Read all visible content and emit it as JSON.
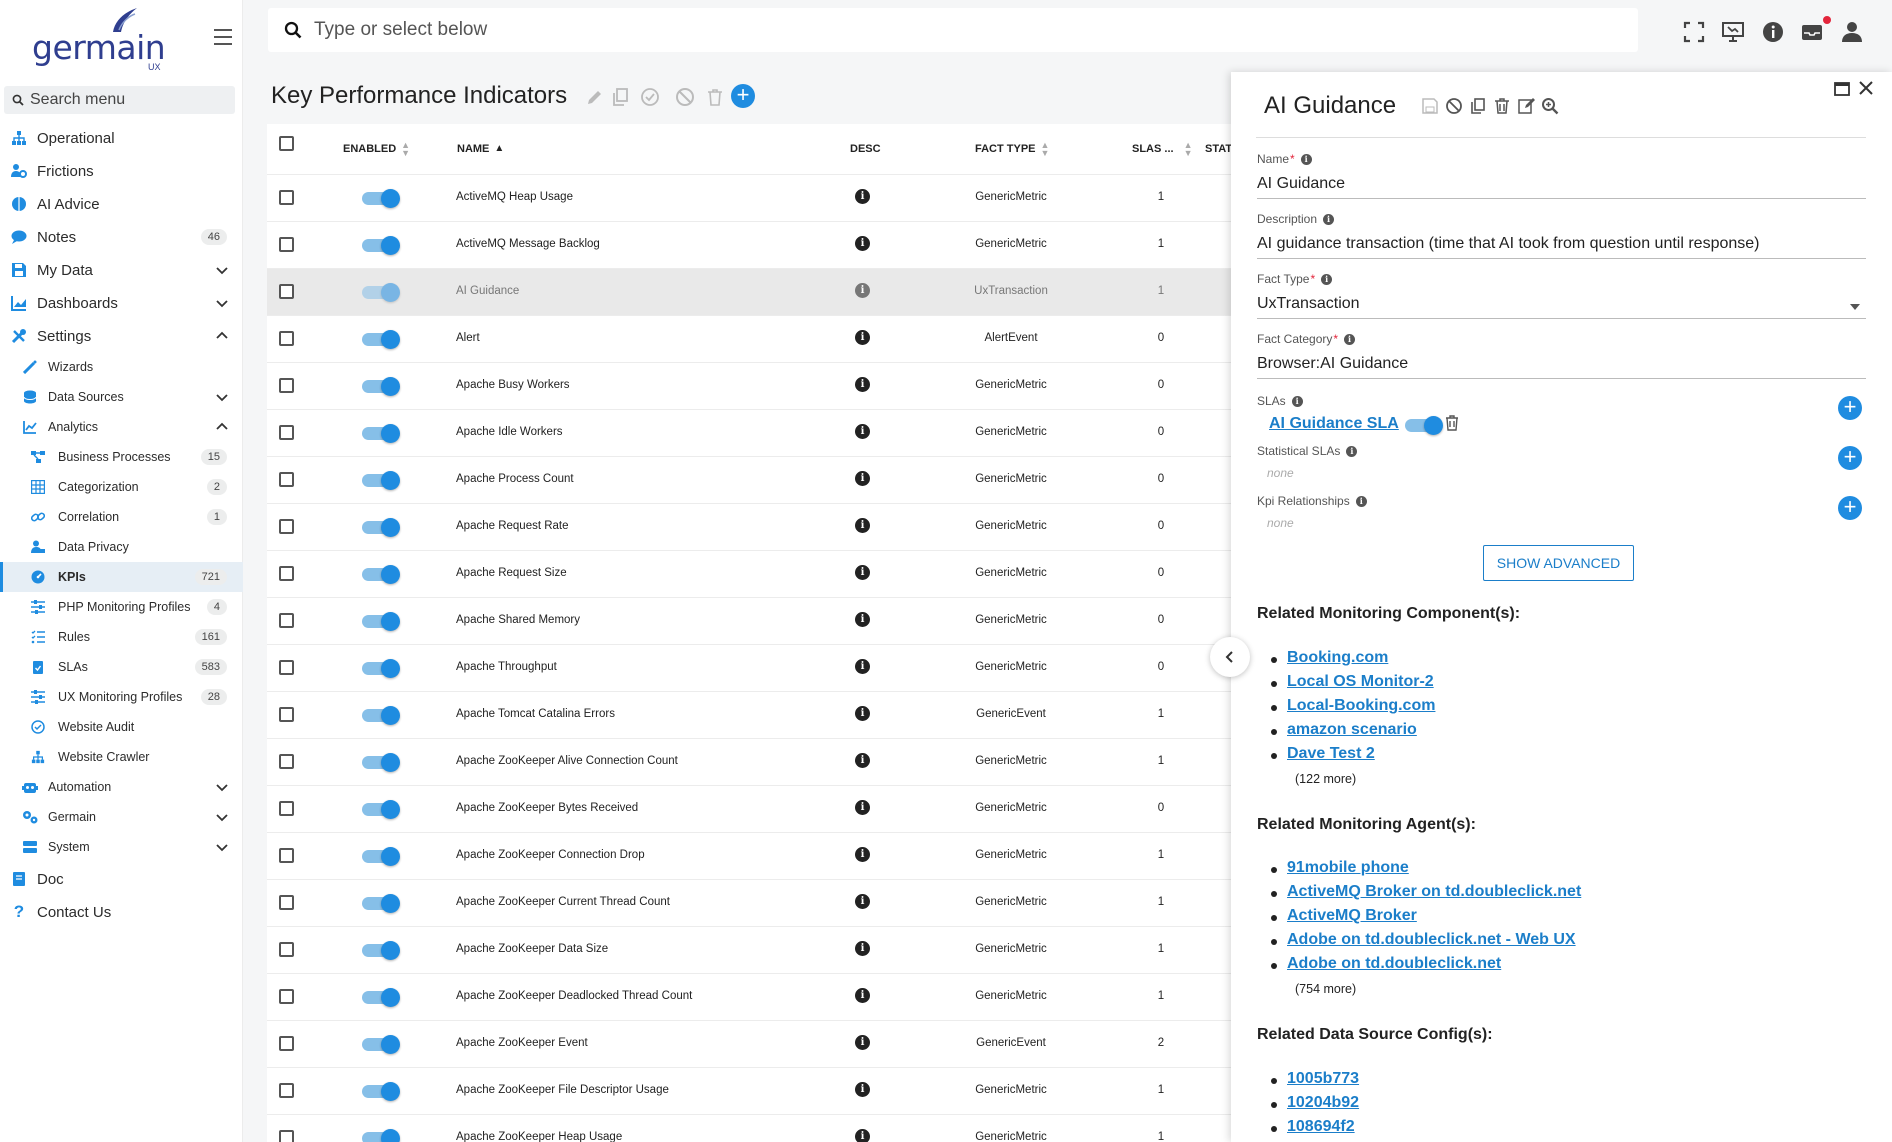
{
  "brand": {
    "logo_text": "germain",
    "logo_sub": "UX"
  },
  "sidebar": {
    "search_placeholder": "Search menu",
    "items": [
      {
        "label": "Operational",
        "icon": "sitemap-icon"
      },
      {
        "label": "Frictions",
        "icon": "user-gear-icon"
      },
      {
        "label": "AI Advice",
        "icon": "brain-icon"
      },
      {
        "label": "Notes",
        "icon": "comment-icon",
        "badge": "46"
      },
      {
        "label": "My Data",
        "icon": "save-icon",
        "expandable": true
      },
      {
        "label": "Dashboards",
        "icon": "chart-icon",
        "expandable": true
      },
      {
        "label": "Settings",
        "icon": "tools-icon",
        "expanded": true
      },
      {
        "label": "Wizards",
        "icon": "wand-icon"
      },
      {
        "label": "Data Sources",
        "icon": "database-icon",
        "expandable": true
      },
      {
        "label": "Analytics",
        "icon": "line-chart-icon",
        "expanded": true
      },
      {
        "label": "Business Processes",
        "icon": "flow-icon",
        "badge": "15"
      },
      {
        "label": "Categorization",
        "icon": "grid-icon",
        "badge": "2"
      },
      {
        "label": "Correlation",
        "icon": "link-icon",
        "badge": "1"
      },
      {
        "label": "Data Privacy",
        "icon": "user-lock-icon"
      },
      {
        "label": "KPIs",
        "icon": "gauge-icon",
        "badge": "721",
        "active": true
      },
      {
        "label": "PHP Monitoring Profiles",
        "icon": "sliders-icon",
        "badge": "4"
      },
      {
        "label": "Rules",
        "icon": "list-icon",
        "badge": "161"
      },
      {
        "label": "SLAs",
        "icon": "clipboard-icon",
        "badge": "583"
      },
      {
        "label": "UX Monitoring Profiles",
        "icon": "sliders-icon",
        "badge": "28"
      },
      {
        "label": "Website Audit",
        "icon": "check-circle-icon"
      },
      {
        "label": "Website Crawler",
        "icon": "sitemap-icon"
      },
      {
        "label": "Automation",
        "icon": "robot-icon",
        "expandable": true
      },
      {
        "label": "Germain",
        "icon": "gears-icon",
        "expandable": true
      },
      {
        "label": "System",
        "icon": "server-icon",
        "expandable": true
      },
      {
        "label": "Doc",
        "icon": "book-icon"
      },
      {
        "label": "Contact Us",
        "icon": "question-icon"
      }
    ]
  },
  "topbar": {
    "search_placeholder": "Type or select below"
  },
  "page": {
    "title": "Key Performance Indicators"
  },
  "table": {
    "columns": {
      "enabled": "ENABLED",
      "name": "NAME",
      "desc": "DESC",
      "fact_type": "FACT TYPE",
      "slas": "SLAS ...",
      "status": "STAT"
    },
    "rows": [
      {
        "name": "ActiveMQ Heap Usage",
        "fact_type": "GenericMetric",
        "slas": "1"
      },
      {
        "name": "ActiveMQ Message Backlog",
        "fact_type": "GenericMetric",
        "slas": "1"
      },
      {
        "name": "AI Guidance",
        "fact_type": "UxTransaction",
        "slas": "1",
        "selected": true
      },
      {
        "name": "Alert",
        "fact_type": "AlertEvent",
        "slas": "0"
      },
      {
        "name": "Apache Busy Workers",
        "fact_type": "GenericMetric",
        "slas": "0"
      },
      {
        "name": "Apache Idle Workers",
        "fact_type": "GenericMetric",
        "slas": "0"
      },
      {
        "name": "Apache Process Count",
        "fact_type": "GenericMetric",
        "slas": "0"
      },
      {
        "name": "Apache Request Rate",
        "fact_type": "GenericMetric",
        "slas": "0"
      },
      {
        "name": "Apache Request Size",
        "fact_type": "GenericMetric",
        "slas": "0"
      },
      {
        "name": "Apache Shared Memory",
        "fact_type": "GenericMetric",
        "slas": "0"
      },
      {
        "name": "Apache Throughput",
        "fact_type": "GenericMetric",
        "slas": "0"
      },
      {
        "name": "Apache Tomcat Catalina Errors",
        "fact_type": "GenericEvent",
        "slas": "1"
      },
      {
        "name": "Apache ZooKeeper Alive Connection Count",
        "fact_type": "GenericMetric",
        "slas": "1"
      },
      {
        "name": "Apache ZooKeeper Bytes Received",
        "fact_type": "GenericMetric",
        "slas": "0"
      },
      {
        "name": "Apache ZooKeeper Connection Drop",
        "fact_type": "GenericMetric",
        "slas": "1"
      },
      {
        "name": "Apache ZooKeeper Current Thread Count",
        "fact_type": "GenericMetric",
        "slas": "1"
      },
      {
        "name": "Apache ZooKeeper Data Size",
        "fact_type": "GenericMetric",
        "slas": "1"
      },
      {
        "name": "Apache ZooKeeper Deadlocked Thread Count",
        "fact_type": "GenericMetric",
        "slas": "1"
      },
      {
        "name": "Apache ZooKeeper Event",
        "fact_type": "GenericEvent",
        "slas": "2"
      },
      {
        "name": "Apache ZooKeeper File Descriptor Usage",
        "fact_type": "GenericMetric",
        "slas": "1"
      },
      {
        "name": "Apache ZooKeeper Heap Usage",
        "fact_type": "GenericMetric",
        "slas": "1"
      }
    ]
  },
  "panel": {
    "title": "AI Guidance",
    "fields": {
      "name_label": "Name",
      "name_value": "AI Guidance",
      "desc_label": "Description",
      "desc_value": "AI guidance transaction (time that AI took from question until response)",
      "fact_type_label": "Fact Type",
      "fact_type_value": "UxTransaction",
      "fact_category_label": "Fact Category",
      "fact_category_value": "Browser:AI Guidance",
      "slas_label": "SLAs",
      "sla_link": "AI Guidance SLA",
      "stat_slas_label": "Statistical SLAs",
      "stat_slas_value": "none",
      "kpi_rel_label": "Kpi Relationships",
      "kpi_rel_value": "none"
    },
    "show_advanced": "SHOW ADVANCED",
    "components": {
      "title": "Related Monitoring Component(s):",
      "items": [
        "Booking.com",
        "Local OS Monitor-2",
        "Local-Booking.com",
        "amazon scenario",
        "Dave Test 2"
      ],
      "more": "(122 more)"
    },
    "agents": {
      "title": "Related Monitoring Agent(s):",
      "items": [
        "91mobile phone",
        "ActiveMQ Broker on td.doubleclick.net",
        "ActiveMQ Broker",
        "Adobe on td.doubleclick.net - Web UX",
        "Adobe on td.doubleclick.net"
      ],
      "more": "(754 more)"
    },
    "datasources": {
      "title": "Related Data Source Config(s):",
      "items": [
        "1005b773",
        "10204b92",
        "108694f2"
      ]
    }
  },
  "colors": {
    "accent": "#1f8ce0",
    "link": "#1b7ec9",
    "brand": "#2f3e8f",
    "notification": "#e3253b"
  }
}
